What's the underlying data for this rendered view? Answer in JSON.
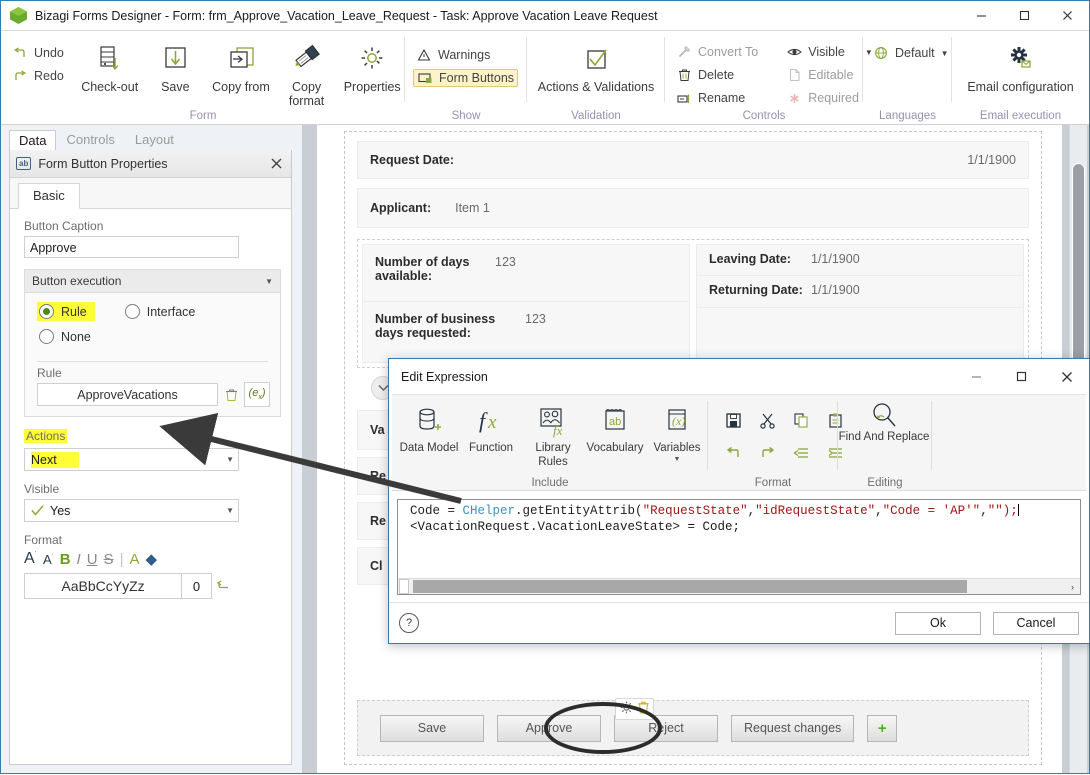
{
  "window": {
    "title": "Bizagi Forms Designer  - Form: frm_Approve_Vacation_Leave_Request - Task:  Approve Vacation Leave Request",
    "minimize": "minimize-button",
    "maximize": "maximize-button",
    "close": "close-button"
  },
  "ribbon": {
    "groups": [
      {
        "name": "Form"
      },
      {
        "name": "Show"
      },
      {
        "name": "Validation"
      },
      {
        "name": "Controls"
      },
      {
        "name": "Languages"
      },
      {
        "name": "Email execution"
      }
    ],
    "undo": "Undo",
    "redo": "Redo",
    "checkout": "Check-out",
    "save": "Save",
    "copy_from": "Copy from",
    "copy_format": "Copy format",
    "properties": "Properties",
    "warnings": "Warnings",
    "form_buttons": "Form Buttons",
    "actions_validations": "Actions & Validations",
    "convert_to": "Convert To",
    "delete": "Delete",
    "rename": "Rename",
    "visible": "Visible",
    "editable": "Editable",
    "required": "Required",
    "default": "Default",
    "email_configuration": "Email configuration"
  },
  "left_panel": {
    "tabs": [
      {
        "label": "Data",
        "active": true
      },
      {
        "label": "Controls",
        "active": false
      },
      {
        "label": "Layout",
        "active": false
      }
    ],
    "panel_title": "Form Button Properties",
    "panel_icon": "ab",
    "inner_tab": "Basic",
    "button_caption_label": "Button Caption",
    "button_caption_value": "Approve",
    "button_execution_label": "Button execution",
    "radio_rule": "Rule",
    "radio_interface": "Interface",
    "radio_none": "None",
    "radio_selected": "Rule",
    "rule_label": "Rule",
    "rule_value": "ApproveVacations",
    "actions_label": "Actions",
    "actions_value": "Next",
    "visible_label": "Visible",
    "visible_value": "Yes",
    "format_label": "Format",
    "format_preview": "AaBbCcYyZz",
    "format_size": "0",
    "format_tools": [
      "A",
      "A",
      "B",
      "I",
      "U",
      "S",
      "A",
      "highlight"
    ]
  },
  "form_canvas": {
    "rows": [
      {
        "label": "Request Date:",
        "value": "1/1/1900",
        "value_align": "right"
      },
      {
        "label": "Applicant:",
        "value": "Item 1",
        "value_align": "left"
      }
    ],
    "left_cells": [
      {
        "label": "Number of days available:",
        "value": "123"
      },
      {
        "label": "Number of business days requested:",
        "value": "123"
      }
    ],
    "right_cells": [
      {
        "label": "Leaving Date:",
        "value": "1/1/1900"
      },
      {
        "label": "Returning Date:",
        "value": "1/1/1900"
      }
    ],
    "hidden_rows": [
      "Va",
      "Re",
      "Re",
      "Cl"
    ],
    "buttons": [
      {
        "label": "Save"
      },
      {
        "label": "Approve"
      },
      {
        "label": "Reject"
      },
      {
        "label": "Request changes"
      },
      {
        "label": "+"
      }
    ],
    "selected_button": "Approve",
    "mini_tools": [
      "gear-icon",
      "trash-icon"
    ]
  },
  "dialog": {
    "title": "Edit Expression",
    "groups": [
      {
        "name": "Include"
      },
      {
        "name": "Format"
      },
      {
        "name": "Editing"
      }
    ],
    "buttons": [
      {
        "label": "Data Model",
        "icon": "database-plus-icon"
      },
      {
        "label": "Function",
        "icon": "fx-icon"
      },
      {
        "label": "Library Rules",
        "icon": "library-rules-icon"
      },
      {
        "label": "Vocabulary",
        "icon": "vocabulary-ab-icon"
      },
      {
        "label": "Variables",
        "icon": "variables-x-icon"
      }
    ],
    "format_icons": [
      "save-icon",
      "cut-icon",
      "copy-icon",
      "paste-icon",
      "undo-icon",
      "redo-icon",
      "outdent-icon",
      "indent-icon"
    ],
    "find_replace": "Find And Replace",
    "code_line1_a": "Code = ",
    "code_line1_b": "CHelper",
    "code_line1_c": ".getEntityAttrib(",
    "code_line1_str1": "\"RequestState\"",
    "code_line1_sep1": ",",
    "code_line1_str2": "\"idRequestState\"",
    "code_line1_sep2": ",",
    "code_line1_str3": "\"Code = 'AP'\"",
    "code_line1_sep3": ",",
    "code_line1_str4": "\"\"",
    "code_line1_end": ");",
    "code_line2": "<VacationRequest.VacationLeaveState> = Code;",
    "ok": "Ok",
    "cancel": "Cancel",
    "help": "?"
  }
}
